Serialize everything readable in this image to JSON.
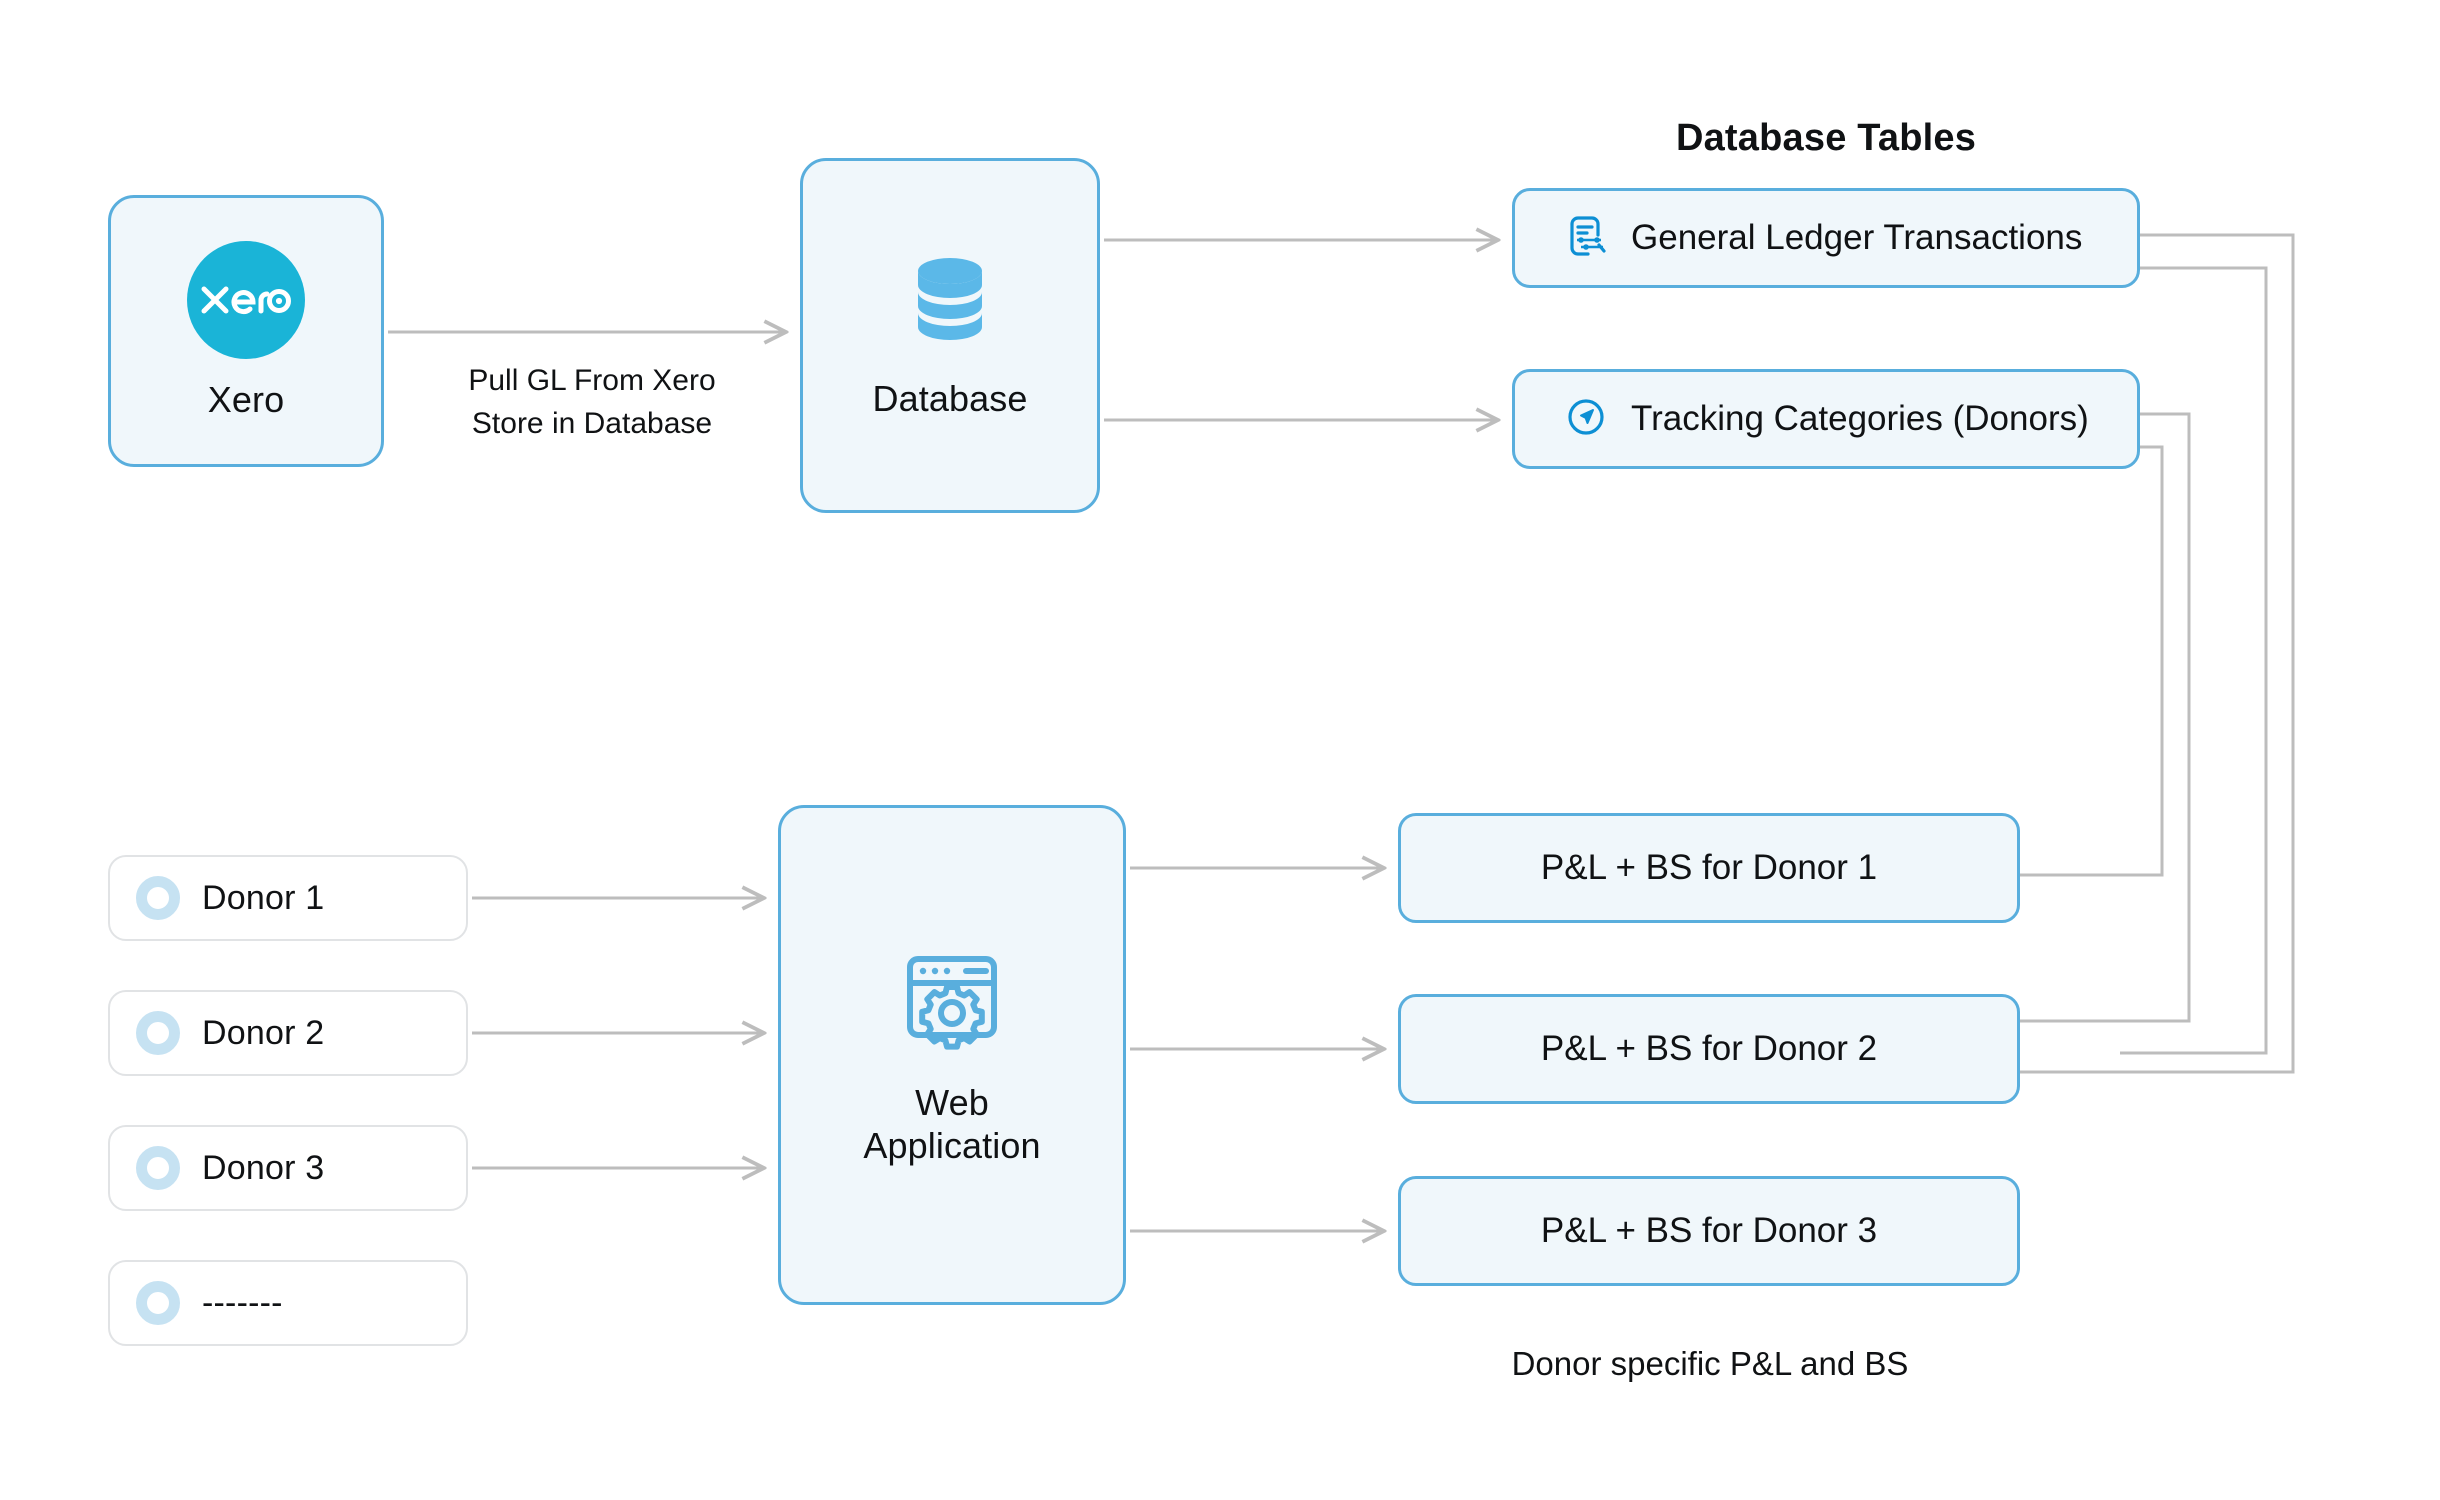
{
  "diagram": {
    "title_database_tables": "Database Tables",
    "caption_outputs": "Donor specific P&L and BS",
    "edge_label_pull_gl": "Pull GL From Xero\nStore in Database",
    "edge_label_pull_gl_line1": "Pull GL From Xero",
    "edge_label_pull_gl_line2": "Store in Database"
  },
  "nodes": {
    "xero": {
      "label": "Xero",
      "logo_text": "xero",
      "icon": "xero-logo-icon"
    },
    "database": {
      "label": "Database",
      "icon": "database-cylinder-icon"
    },
    "webapp": {
      "label": "Web\nApplication",
      "label_line1": "Web",
      "label_line2": "Application",
      "icon": "browser-gear-icon"
    }
  },
  "database_tables": [
    {
      "label": "General Ledger Transactions",
      "icon": "ledger-document-icon"
    },
    {
      "label": "Tracking Categories (Donors)",
      "icon": "navigation-arrow-circle-icon"
    }
  ],
  "donors": [
    {
      "label": "Donor 1",
      "icon": "donor-ring-icon"
    },
    {
      "label": "Donor 2",
      "icon": "donor-ring-icon"
    },
    {
      "label": "Donor 3",
      "icon": "donor-ring-icon"
    },
    {
      "label": "-------",
      "icon": "donor-ring-icon"
    }
  ],
  "outputs": [
    {
      "label": "P&L + BS for Donor 1"
    },
    {
      "label": "P&L + BS for Donor 2"
    },
    {
      "label": "P&L + BS for Donor 3"
    }
  ],
  "colors": {
    "accent_border": "#59aedd",
    "node_fill": "#f0f7fb",
    "xero_brand": "#1ab4d7",
    "icon_blue": "#0d8fd4",
    "db_icon_blue": "#5bb8e8",
    "connector_gray": "#bdbdbd",
    "donor_ring": "#c6e2f2",
    "donor_border": "#e1e3e5",
    "text": "#101214",
    "background": "#ffffff"
  }
}
